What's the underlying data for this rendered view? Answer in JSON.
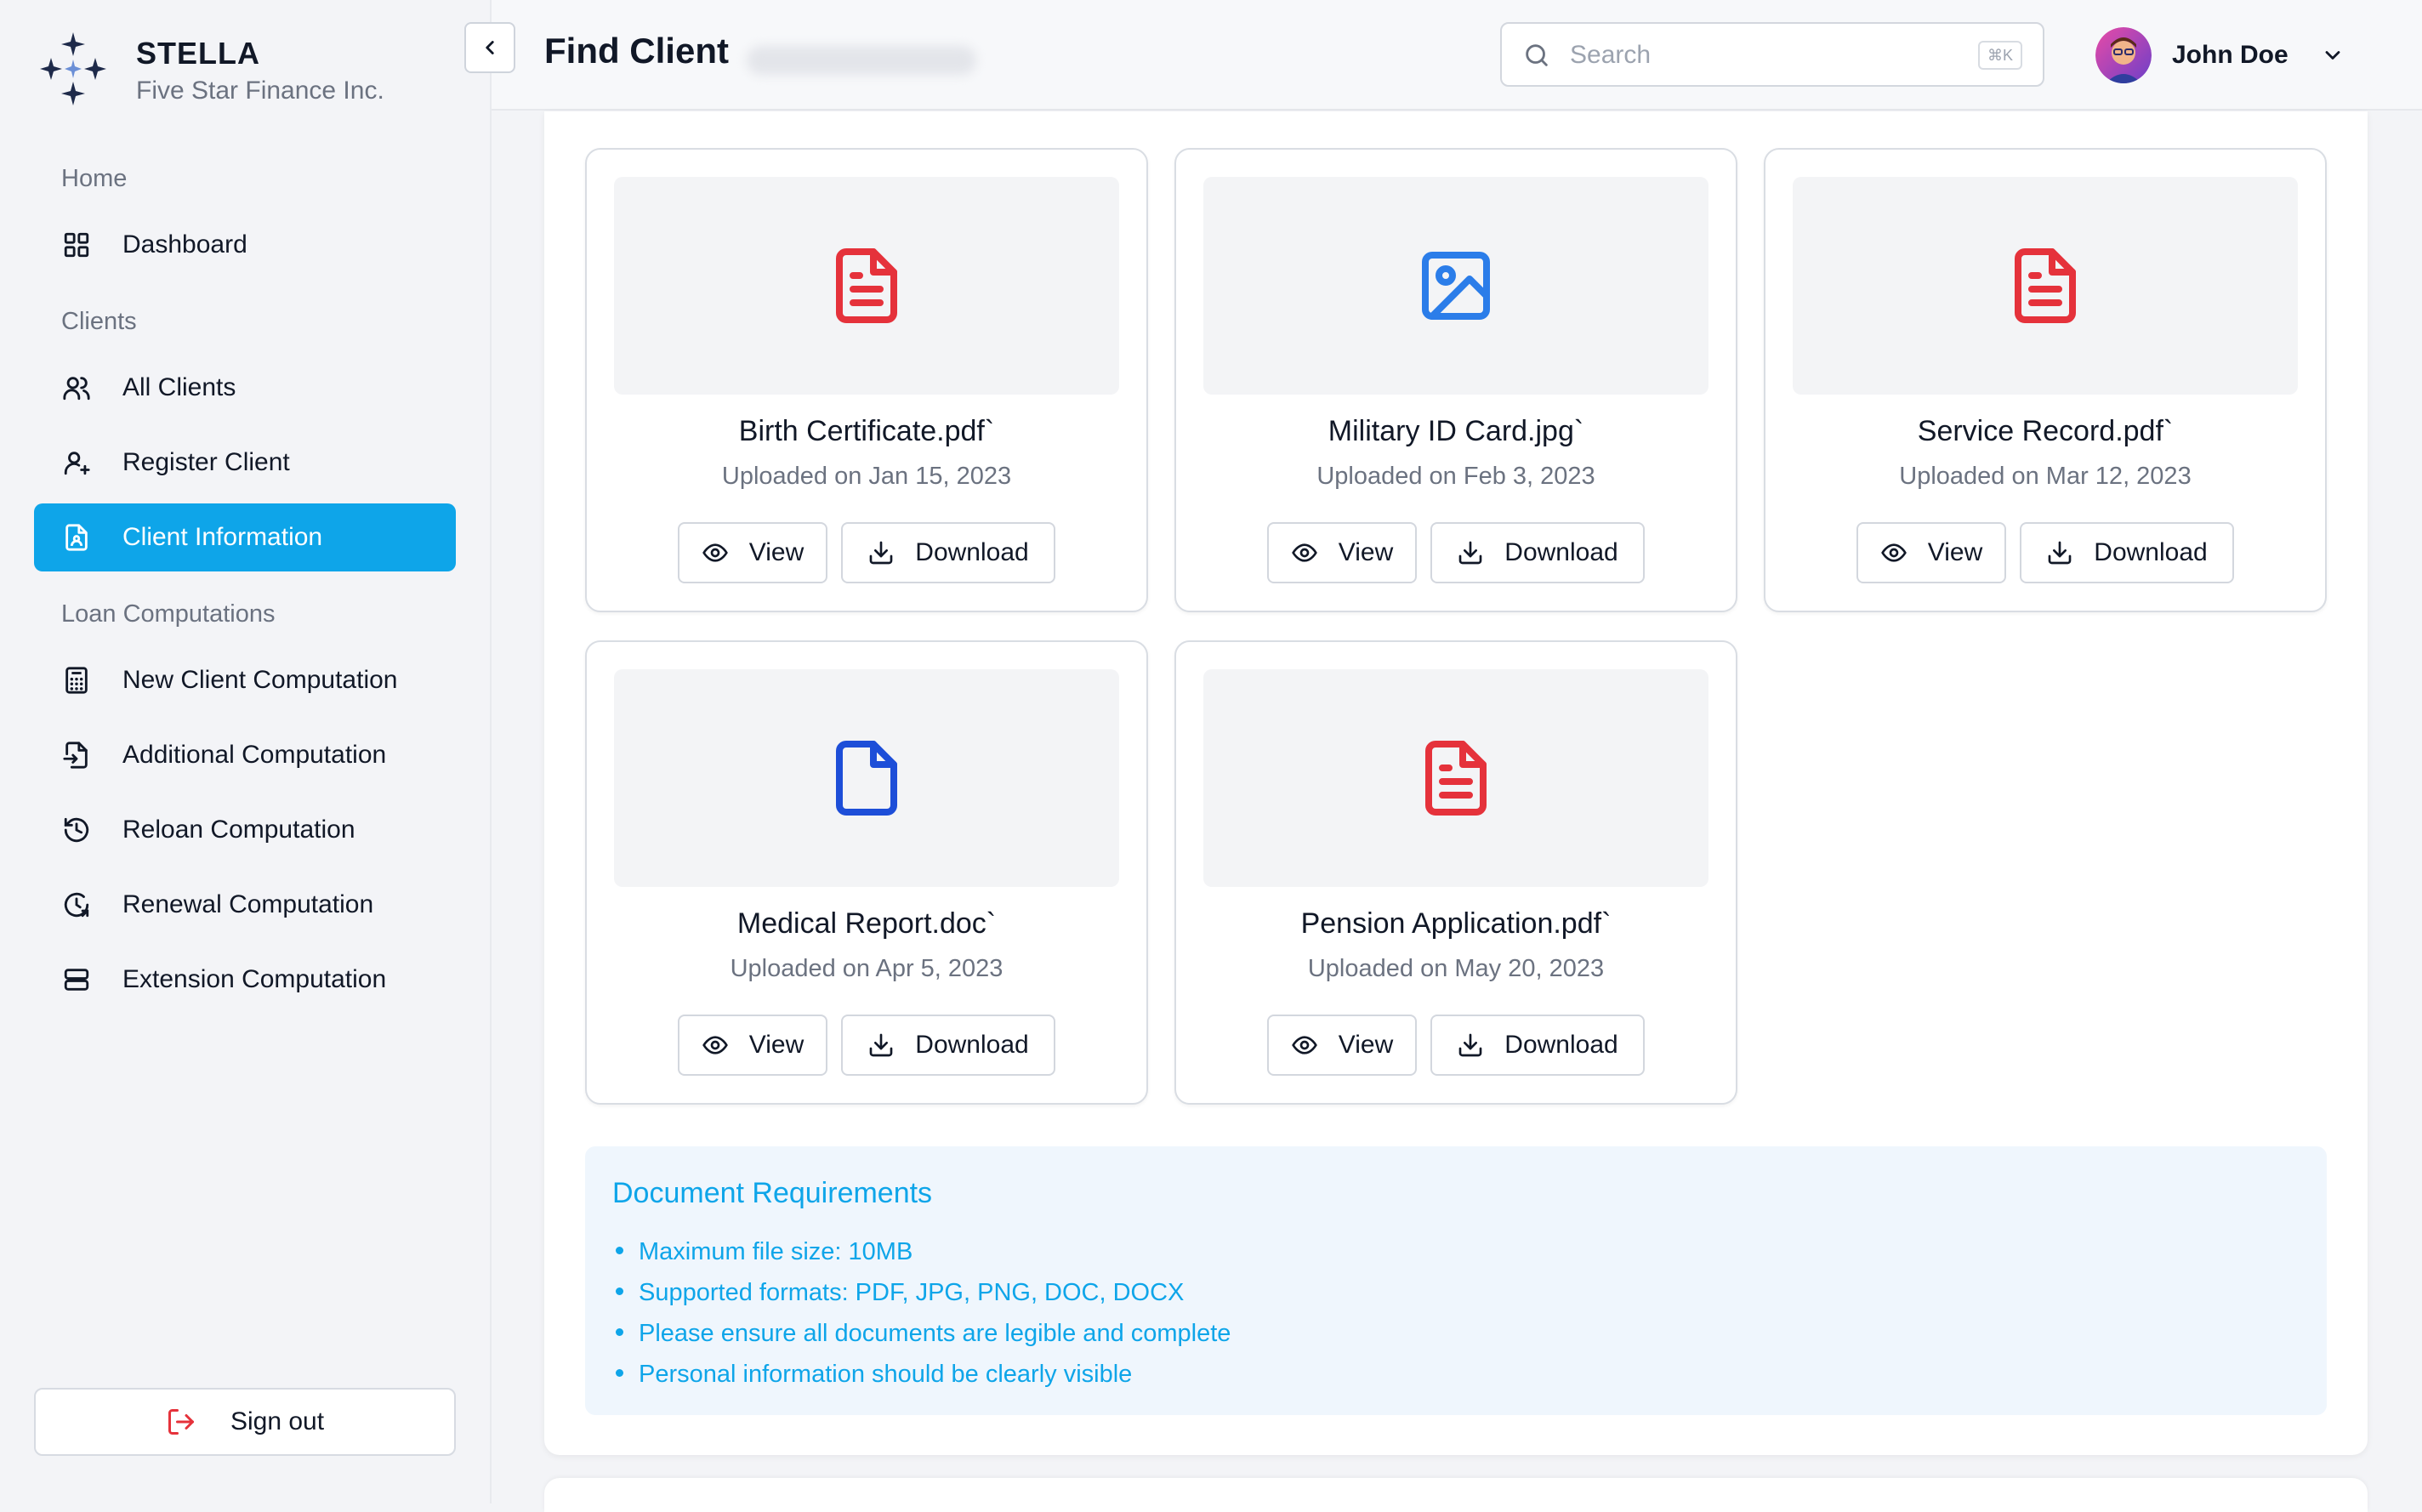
{
  "brand": {
    "name": "STELLA",
    "subtitle": "Five Star Finance Inc."
  },
  "sidebar": {
    "sections": [
      {
        "label": "Home",
        "items": [
          {
            "label": "Dashboard",
            "icon": "grid-icon"
          }
        ]
      },
      {
        "label": "Clients",
        "items": [
          {
            "label": "All Clients",
            "icon": "users-icon"
          },
          {
            "label": "Register Client",
            "icon": "user-plus-icon"
          },
          {
            "label": "Client Information",
            "icon": "file-user-icon",
            "active": true
          }
        ]
      },
      {
        "label": "Loan Computations",
        "items": [
          {
            "label": "New Client Computation",
            "icon": "calculator-icon"
          },
          {
            "label": "Additional Computation",
            "icon": "file-input-icon"
          },
          {
            "label": "Reloan Computation",
            "icon": "history-icon"
          },
          {
            "label": "Renewal Computation",
            "icon": "clock-refresh-icon"
          },
          {
            "label": "Extension Computation",
            "icon": "server-icon"
          }
        ]
      }
    ],
    "signout_label": "Sign out"
  },
  "header": {
    "title": "Find Client",
    "search_placeholder": "Search",
    "search_shortcut": "⌘K",
    "user_name": "John Doe"
  },
  "documents": [
    {
      "name": "Birth Certificate.pdf`",
      "date": "Uploaded on Jan 15, 2023",
      "icon": "file-text-icon",
      "color": "#e5323b"
    },
    {
      "name": "Military ID Card.jpg`",
      "date": "Uploaded on Feb 3, 2023",
      "icon": "image-icon",
      "color": "#2b7de9"
    },
    {
      "name": "Service Record.pdf`",
      "date": "Uploaded on Mar 12, 2023",
      "icon": "file-text-icon",
      "color": "#e5323b"
    },
    {
      "name": "Medical Report.doc`",
      "date": "Uploaded on Apr 5, 2023",
      "icon": "file-icon",
      "color": "#1d4ed8"
    },
    {
      "name": "Pension Application.pdf`",
      "date": "Uploaded on May 20, 2023",
      "icon": "file-text-icon",
      "color": "#e5323b"
    }
  ],
  "actions": {
    "view_label": "View",
    "download_label": "Download"
  },
  "requirements": {
    "title": "Document Requirements",
    "items": [
      "Maximum file size: 10MB",
      "Supported formats: PDF, JPG, PNG, DOC, DOCX",
      "Please ensure all documents are legible and complete",
      "Personal information should be clearly visible"
    ]
  },
  "colors": {
    "accent": "#0ea5e9",
    "pdf": "#e5323b",
    "image": "#2b7de9",
    "doc": "#1d4ed8"
  }
}
